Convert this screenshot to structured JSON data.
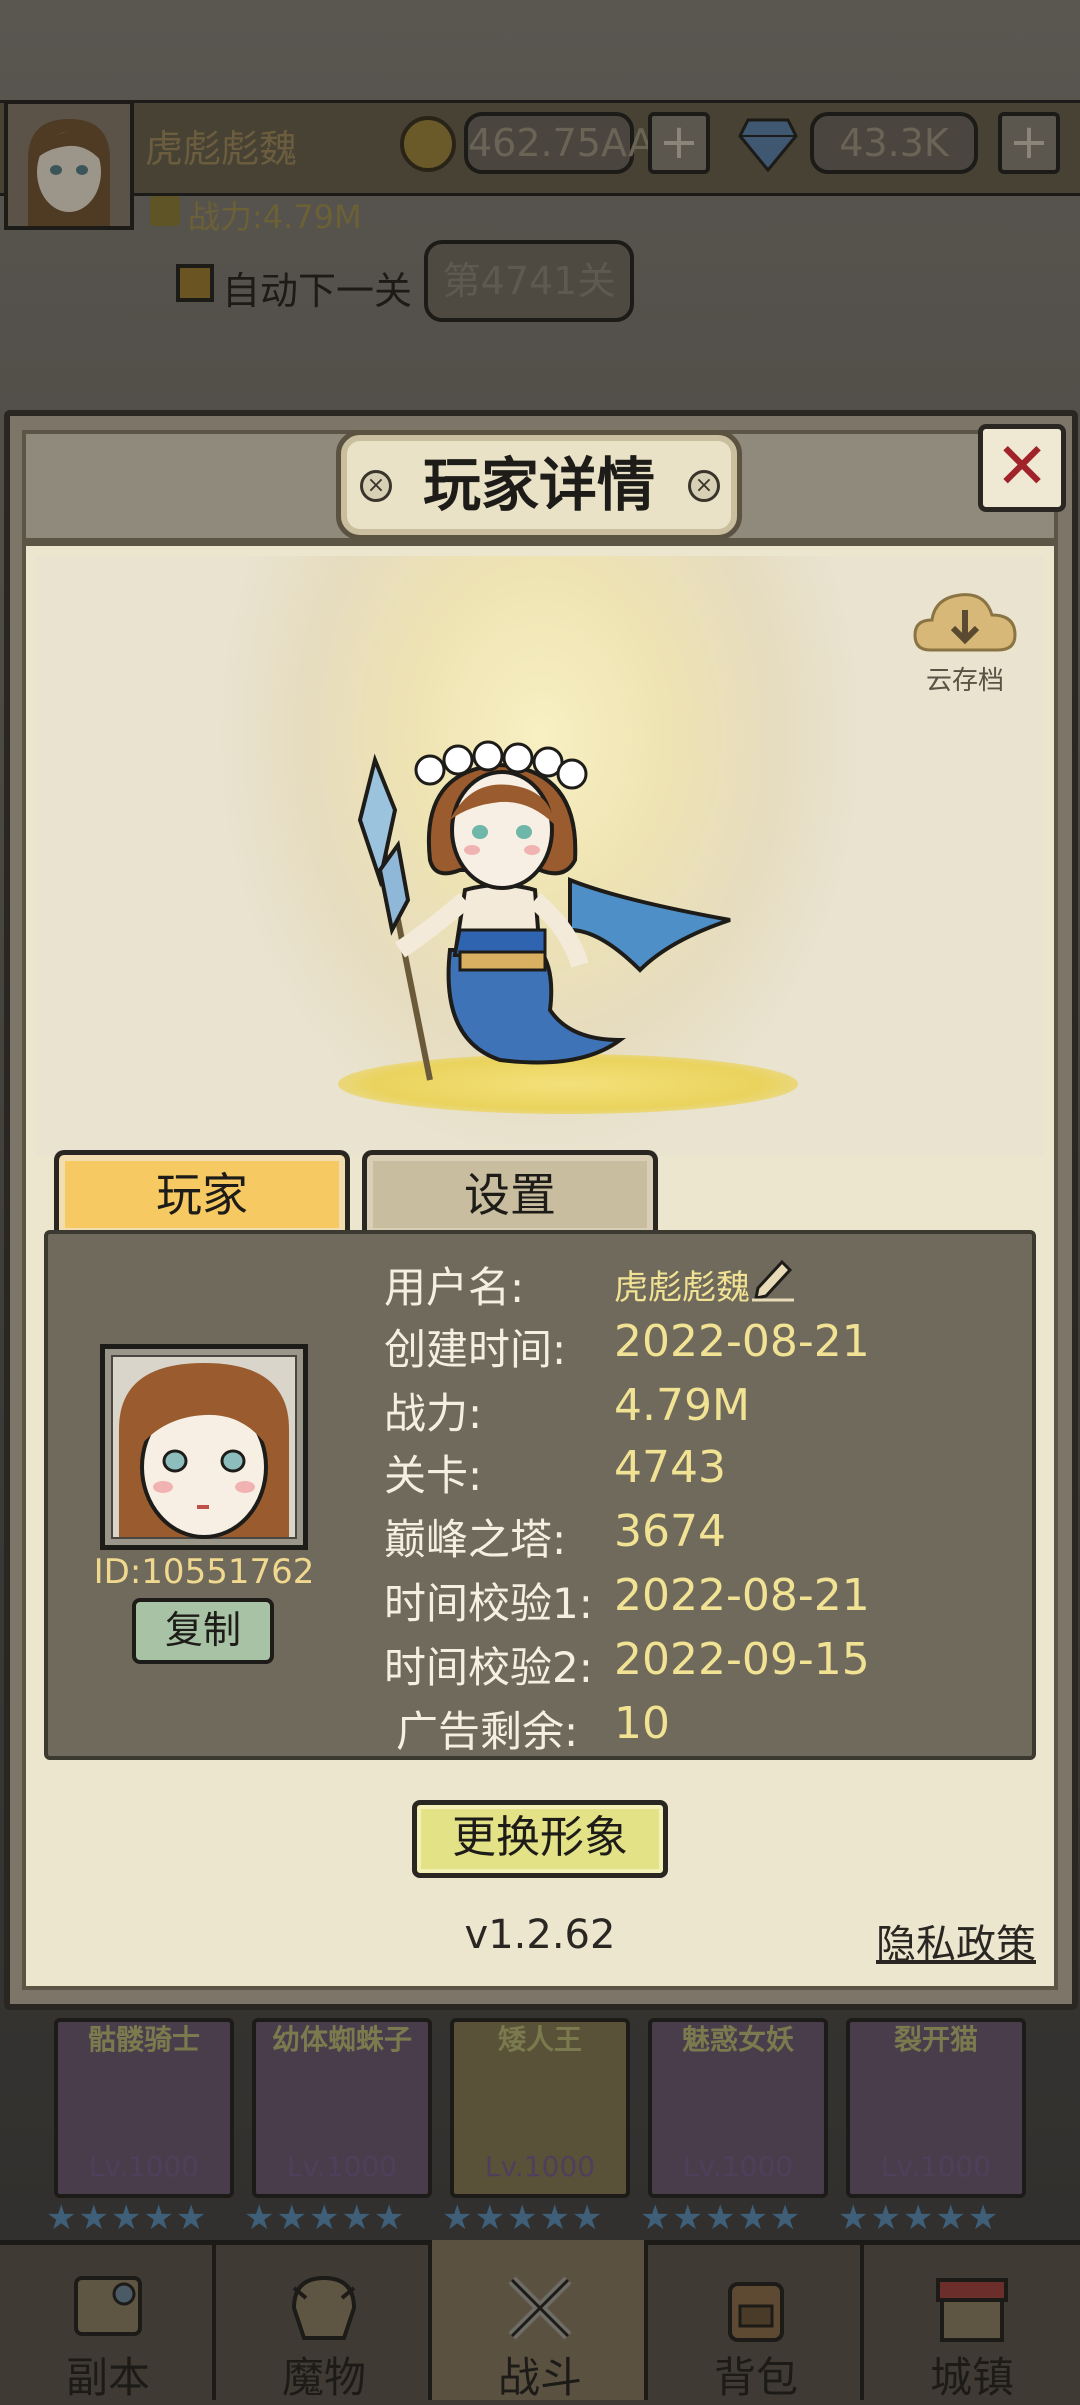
{
  "top_bar": {
    "player_name": "虎彪彪魏",
    "coins": "462.75AA",
    "gems": "43.3K",
    "power": "战力:4.79M",
    "auto_next_label": "自动下一关",
    "stage_label": "第4741关"
  },
  "modal": {
    "title": "玩家详情",
    "close_icon": "close-icon",
    "cloud_save_label": "云存档",
    "tabs": [
      {
        "label": "玩家",
        "active": true
      },
      {
        "label": "设置",
        "active": false
      }
    ],
    "player_id": "ID:10551762",
    "copy_label": "复制",
    "info": [
      {
        "label": "用户名:",
        "value": "虎彪彪魏"
      },
      {
        "label": "创建时间:",
        "value": "2022-08-21"
      },
      {
        "label": "战力:",
        "value": "4.79M"
      },
      {
        "label": "关卡:",
        "value": "4743"
      },
      {
        "label": "巅峰之塔:",
        "value": "3674"
      },
      {
        "label": "时间校验1:",
        "value": "2022-08-21"
      },
      {
        "label": "时间校验2:",
        "value": "2022-09-15"
      },
      {
        "label": "广告剩余:",
        "value": "10"
      }
    ],
    "change_avatar_label": "更换形象",
    "version": "v1.2.62",
    "privacy_label": "隐私政策"
  },
  "hero_cards": [
    {
      "name": "骷髅骑士",
      "level": "Lv.1000"
    },
    {
      "name": "幼体蜘蛛子",
      "level": "Lv.1000"
    },
    {
      "name": "矮人王",
      "level": "Lv.1000"
    },
    {
      "name": "魅惑女妖",
      "level": "Lv.1000"
    },
    {
      "name": "裂开猫",
      "level": "Lv.1000"
    }
  ],
  "bottom_nav": [
    {
      "label": "副本",
      "icon": "map-icon",
      "active": false
    },
    {
      "label": "魔物",
      "icon": "monster-icon",
      "active": false
    },
    {
      "label": "战斗",
      "icon": "swords-icon",
      "active": true
    },
    {
      "label": "背包",
      "icon": "backpack-icon",
      "active": false
    },
    {
      "label": "城镇",
      "icon": "town-icon",
      "active": false
    }
  ],
  "colors": {
    "accent_gold": "#f6c963",
    "value_yellow": "#f2e294",
    "close_red": "#a0232a"
  }
}
